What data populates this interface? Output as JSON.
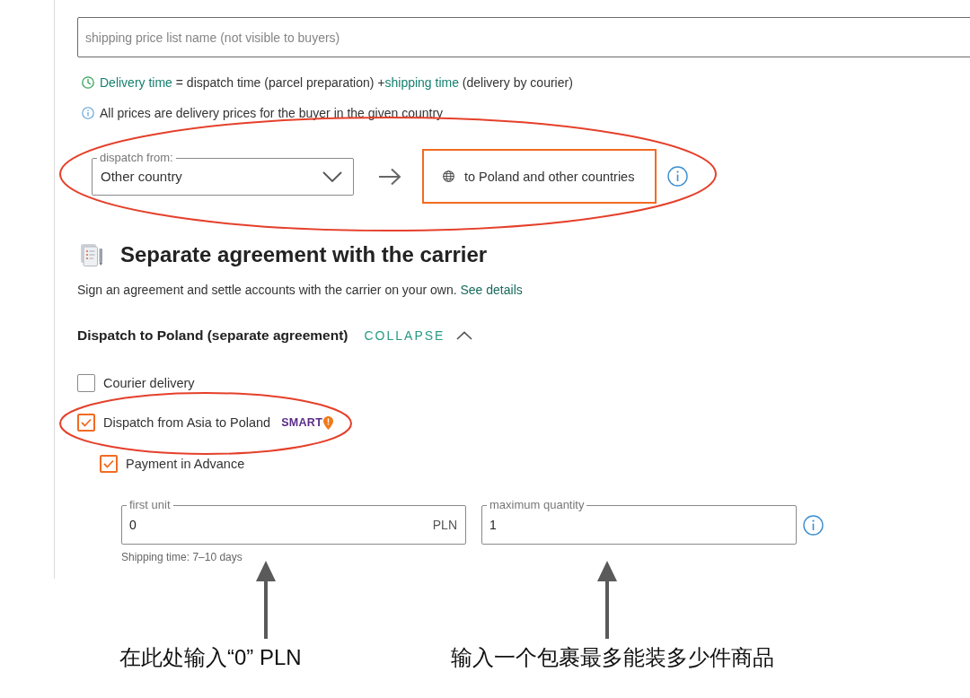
{
  "name_field": {
    "placeholder": "shipping price list name (not visible to buyers)"
  },
  "notes": [
    {
      "kind": "clock",
      "segments": [
        {
          "text": "Delivery time",
          "kind": "term"
        },
        {
          "text": " = dispatch time (parcel preparation) +",
          "kind": "plain"
        },
        {
          "text": "shipping time",
          "kind": "term"
        },
        {
          "text": " (delivery by courier)",
          "kind": "plain"
        }
      ]
    },
    {
      "kind": "info",
      "segments": [
        {
          "text": "All prices are delivery prices for the buyer in the given country",
          "kind": "plain"
        }
      ]
    }
  ],
  "dispatch": {
    "label": "dispatch from:",
    "value": "Other country",
    "destination": "to Poland and other countries",
    "highlighted": true
  },
  "section": {
    "title": "Separate agreement with the carrier",
    "description": "Sign an agreement and settle accounts with the carrier on your own.",
    "link": "See details"
  },
  "group": {
    "title": "Dispatch to Poland (separate agreement)",
    "toggle": "COLLAPSE",
    "expanded": true,
    "options": [
      {
        "label": "Courier delivery",
        "checked": false,
        "highlighted": false
      },
      {
        "label": "Dispatch from Asia to Poland",
        "checked": true,
        "highlighted": true,
        "badge": "SMART",
        "children": [
          {
            "label": "Payment in Advance",
            "checked": true,
            "highlighted": false
          }
        ]
      }
    ],
    "price_fields": [
      {
        "label": "first unit",
        "value": "0",
        "unit": "PLN"
      },
      {
        "label": "maximum quantity",
        "value": "1"
      }
    ],
    "shipping_time": "Shipping time: 7–10 days"
  },
  "callouts": [
    {
      "text": "在此处输入“0” PLN"
    },
    {
      "text": "输入一个包裹最多能装多少件商品"
    }
  ]
}
